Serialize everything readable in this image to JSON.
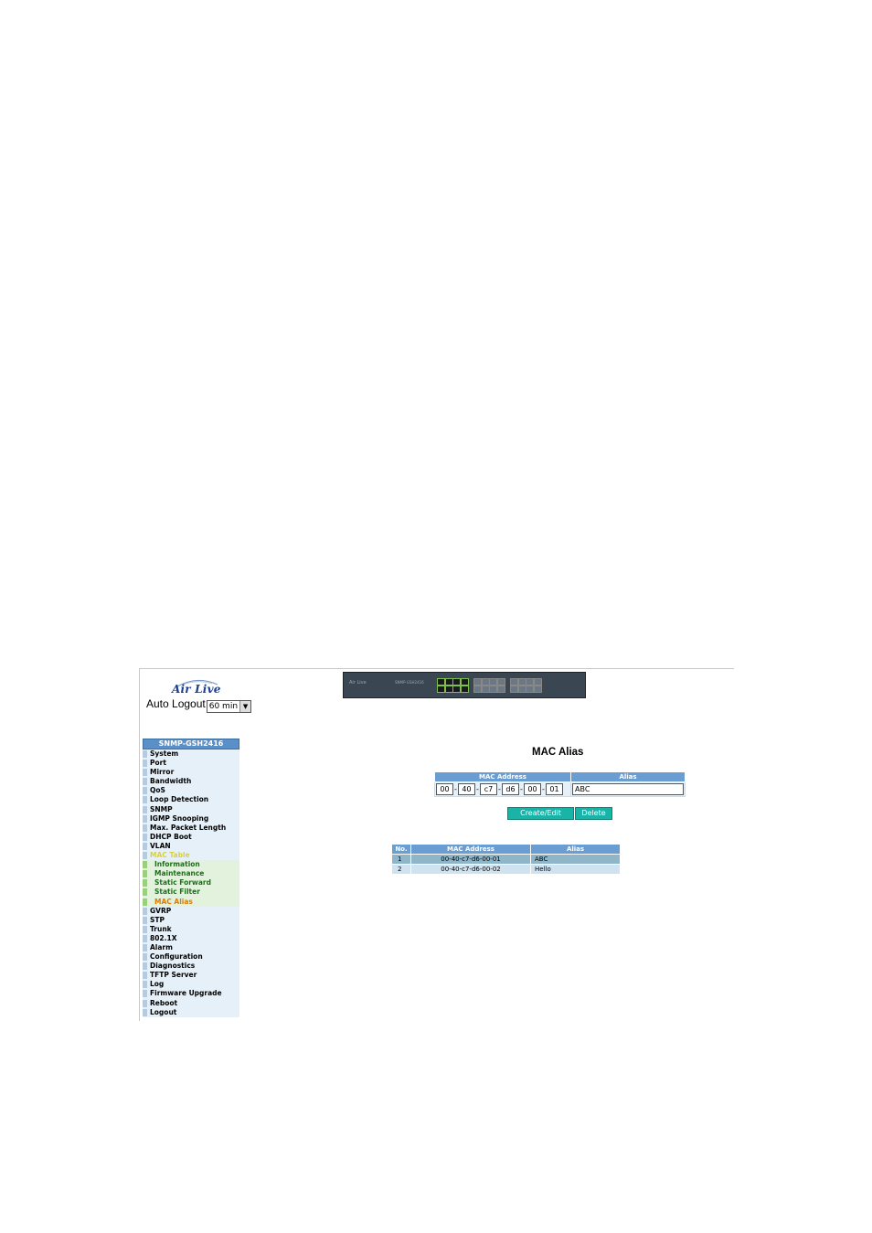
{
  "logo": {
    "text": "Air Live"
  },
  "auto_logout": {
    "label": "Auto Logout",
    "selected": "60 min"
  },
  "switch_image": {
    "brand_text": "Air Live",
    "info_text": "SNMP-GSH2416"
  },
  "sidebar": {
    "title": "SNMP-GSH2416",
    "items": [
      "System",
      "Port",
      "Mirror",
      "Bandwidth",
      "QoS",
      "Loop Detection",
      "SNMP",
      "IGMP Snooping",
      "Max. Packet Length",
      "DHCP Boot",
      "VLAN",
      "MAC Table"
    ],
    "sub_items": [
      "Information",
      "Maintenance",
      "Static Forward",
      "Static Filter",
      "MAC Alias"
    ],
    "items_after": [
      "GVRP",
      "STP",
      "Trunk",
      "802.1X",
      "Alarm",
      "Configuration",
      "Diagnostics",
      "TFTP Server",
      "Log",
      "Firmware Upgrade",
      "Reboot",
      "Logout"
    ]
  },
  "main": {
    "title": "MAC Alias",
    "form": {
      "col_mac": "MAC Address",
      "col_alias": "Alias",
      "octets": [
        "00",
        "40",
        "c7",
        "d6",
        "00",
        "01"
      ],
      "alias_value": "ABC"
    },
    "buttons": {
      "create": "Create/Edit",
      "delete": "Delete"
    },
    "list": {
      "headers": [
        "No.",
        "MAC Address",
        "Alias"
      ],
      "rows": [
        {
          "no": "1",
          "mac": "00-40-c7-d6-00-01",
          "alias": "ABC"
        },
        {
          "no": "2",
          "mac": "00-40-c7-d6-00-02",
          "alias": "Hello"
        }
      ]
    }
  },
  "colors": {
    "header_blue": "#6a9ed3",
    "button_teal": "#1ab3a8",
    "active_menu": "#d8d040",
    "current_submenu": "#e07b00"
  }
}
